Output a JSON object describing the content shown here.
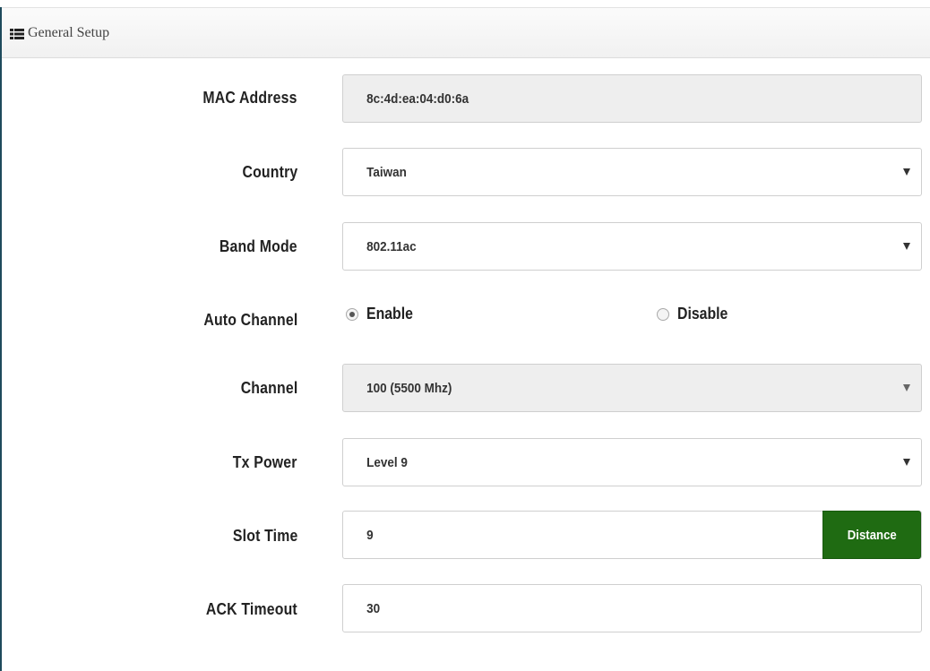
{
  "panel": {
    "title": "General Setup",
    "icon": "list-icon"
  },
  "fields": {
    "mac_address": {
      "label": "MAC Address",
      "value": "8c:4d:ea:04:d0:6a"
    },
    "country": {
      "label": "Country",
      "value": "Taiwan"
    },
    "band_mode": {
      "label": "Band Mode",
      "value": "802.11ac"
    },
    "auto_channel": {
      "label": "Auto Channel",
      "enable_label": "Enable",
      "disable_label": "Disable",
      "selected": "Enable"
    },
    "channel": {
      "label": "Channel",
      "value": "100 (5500 Mhz)"
    },
    "tx_power": {
      "label": "Tx Power",
      "value": "Level 9"
    },
    "slot_time": {
      "label": "Slot Time",
      "value": "9",
      "button_label": "Distance"
    },
    "ack_timeout": {
      "label": "ACK Timeout",
      "value": "30"
    }
  },
  "colors": {
    "accent_button": "#1f6b12",
    "panel_border": "#1e4a5c"
  }
}
